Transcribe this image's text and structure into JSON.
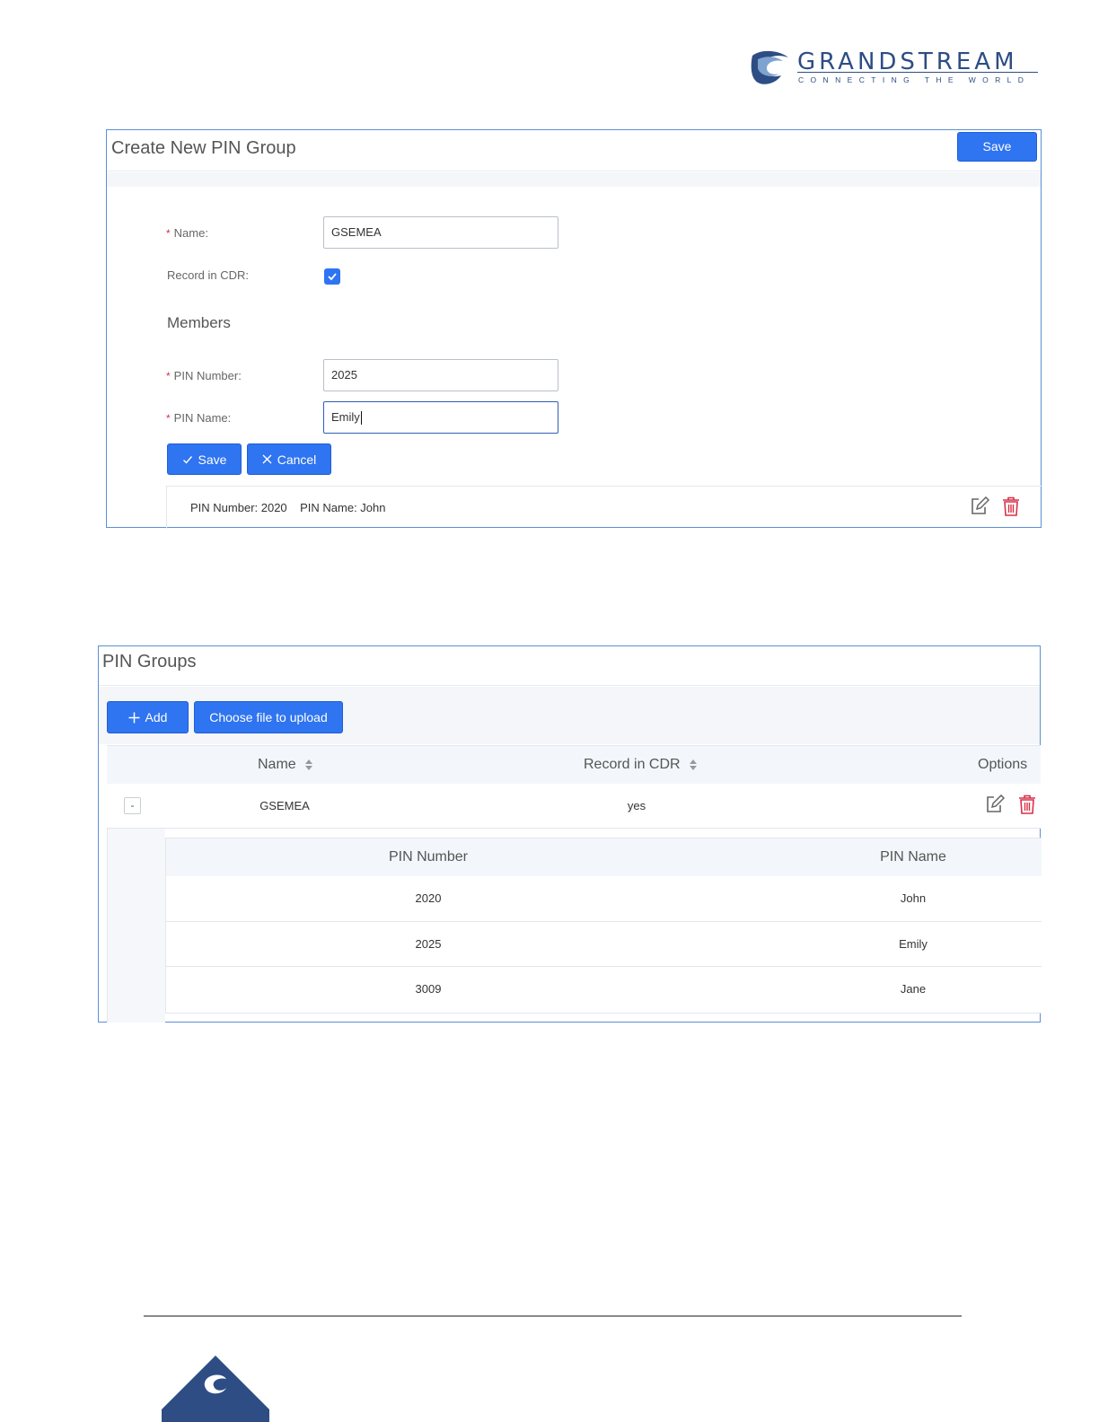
{
  "logo": {
    "brand": "GRANDSTREAM",
    "tagline": "CONNECTING THE WORLD"
  },
  "create_panel": {
    "title": "Create New PIN Group",
    "save_label": "Save",
    "name_label": "Name:",
    "name_value": "GSEMEA",
    "record_cdr_label": "Record in CDR:",
    "record_cdr_checked": true,
    "members_title": "Members",
    "pin_number_label": "PIN Number:",
    "pin_number_value": "2025",
    "pin_name_label": "PIN Name:",
    "pin_name_value": "Emily",
    "member_save_label": "Save",
    "member_cancel_label": "Cancel",
    "existing_member": "PIN Number: 2020    PIN Name: John"
  },
  "groups_panel": {
    "title": "PIN Groups",
    "add_label": "Add",
    "upload_label": "Choose file to upload",
    "columns": {
      "name": "Name",
      "record_cdr": "Record in CDR",
      "options": "Options"
    },
    "row": {
      "collapse": "-",
      "name": "GSEMEA",
      "record_cdr": "yes"
    },
    "sub_columns": {
      "pin_number": "PIN Number",
      "pin_name": "PIN Name"
    },
    "members": [
      {
        "pin_number": "2020",
        "pin_name": "John"
      },
      {
        "pin_number": "2025",
        "pin_name": "Emily"
      },
      {
        "pin_number": "3009",
        "pin_name": "Jane"
      }
    ]
  },
  "colors": {
    "primary": "#2f74f0",
    "brand": "#2d4d84",
    "danger": "#d9304a"
  }
}
